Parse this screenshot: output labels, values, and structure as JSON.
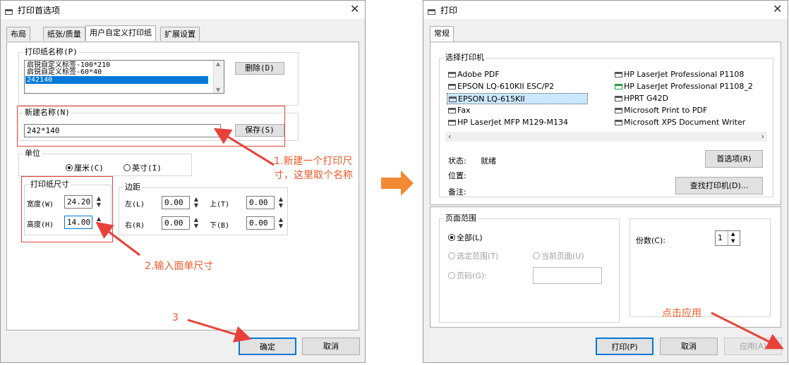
{
  "left_dialog": {
    "title": "打印首选项",
    "tabs": [
      "布局",
      "纸张/质量",
      "用户自定义打印纸",
      "扩展设置"
    ],
    "paper_name_label": "打印纸名称(P)",
    "paper_list": [
      "启锐自定义标签-100*210",
      "启锐自定义标签-60*40",
      "242140"
    ],
    "delete_button": "删除(D)",
    "new_name_label": "新建名称(N)",
    "new_name_value": "242*140",
    "save_button": "保存(S)",
    "unit_label": "单位",
    "unit_cm": "厘米(C)",
    "unit_inch": "英寸(I)",
    "paper_size_label": "打印纸尺寸",
    "width_label": "宽度(W)",
    "width_value": "24.20",
    "height_label": "高度(H)",
    "height_value": "14.00",
    "margin_label": "边距",
    "left_label": "左(L)",
    "left_value": "0.00",
    "right_label": "右(R)",
    "right_value": "0.00",
    "top_label": "上(T)",
    "top_value": "0.00",
    "bottom_label": "下(B)",
    "bottom_value": "0.00",
    "ok_button": "确定",
    "cancel_button": "取消"
  },
  "annotations": {
    "step1_line1": "1.新建一个打印尺",
    "step1_line2": "寸，这里取个名称",
    "step2": "2.输入面单尺寸",
    "step3": "3",
    "apply_hint": "点击应用"
  },
  "right_dialog": {
    "title": "打印",
    "tab": "常规",
    "select_printer_label": "选择打印机",
    "printers_col1": [
      "Adobe PDF",
      "EPSON LQ-610KII ESC/P2",
      "EPSON LQ-615KII",
      "Fax",
      "HP LaserJet MFP M129-M134"
    ],
    "printers_col2": [
      "HP LaserJet Professional P1108",
      "HP LaserJet Professional P1108_2",
      "HPRT G42D",
      "Microsoft Print to PDF",
      "Microsoft XPS Document Writer"
    ],
    "status_label": "状态:",
    "status_value": "就绪",
    "location_label": "位置:",
    "comment_label": "备注:",
    "preferences_button": "首选项(R)",
    "find_printer_button": "查找打印机(D)...",
    "page_range_label": "页面范围",
    "all_label": "全部(L)",
    "selection_label": "选定范围(T)",
    "current_page_label": "当前页面(U)",
    "pages_label": "页码(G):",
    "copies_label": "份数(C):",
    "copies_value": "1",
    "print_button": "打印(P)",
    "cancel_button": "取消",
    "apply_button": "应用(A)"
  },
  "colors": {
    "annotation": "#ef5a2a",
    "highlight_box": "#e8413a",
    "selection": "#0078d7",
    "arrow": "#f08a35"
  }
}
